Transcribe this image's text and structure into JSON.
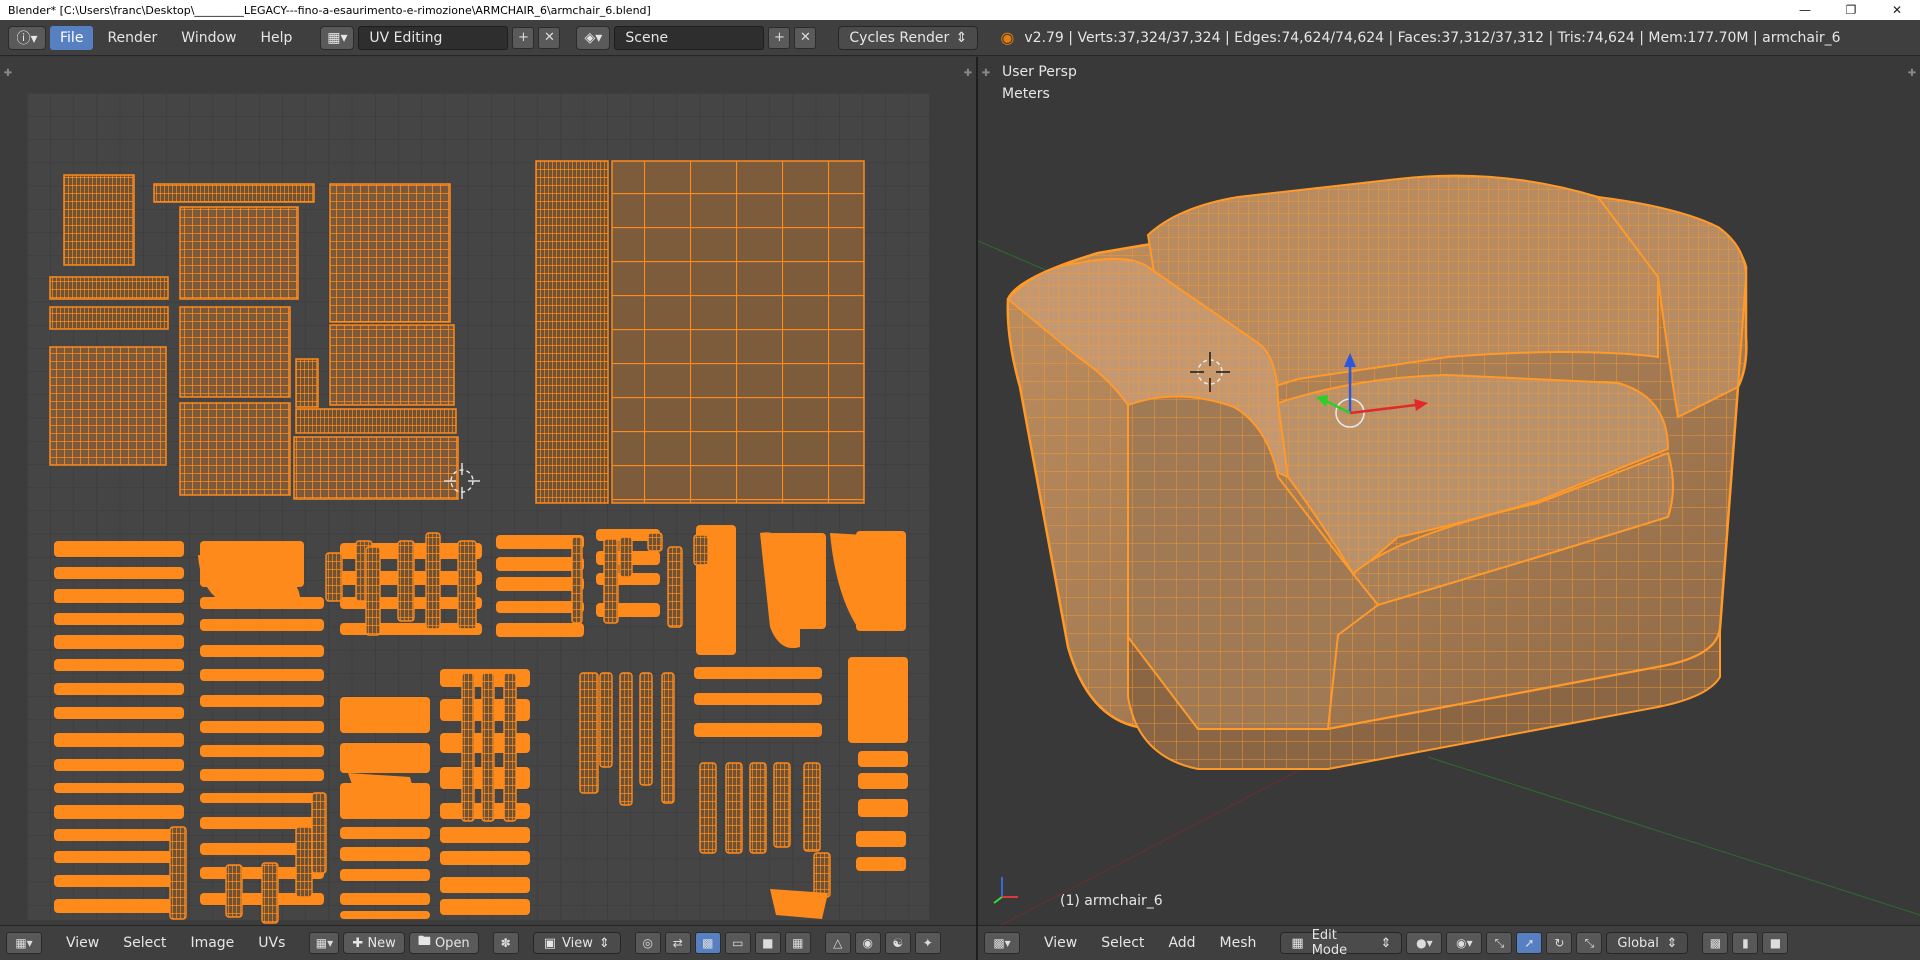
{
  "window": {
    "title": "Blender* [C:\\Users\\franc\\Desktop\\_________LEGACY---fino-a-esaurimento-e-rimozione\\ARMCHAIR_6\\armchair_6.blend]",
    "minimize_icon": "minimize-icon",
    "maximize_icon": "maximize-icon",
    "close_icon": "close-icon"
  },
  "infobar": {
    "menus": [
      "File",
      "Render",
      "Window",
      "Help"
    ],
    "screen_layout": "UV Editing",
    "scene": "Scene",
    "render_engine": "Cycles Render",
    "stats": "v2.79 | Verts:37,324/37,324 | Edges:74,624/74,624 | Faces:37,312/37,312 | Tris:74,624 | Mem:177.70M | armchair_6"
  },
  "viewport": {
    "view_name": "User Persp",
    "units": "Meters",
    "object_label": "(1) armchair_6"
  },
  "uv_footer": {
    "menus": [
      "View",
      "Select",
      "Image",
      "UVs"
    ],
    "new_label": "New",
    "open_label": "Open",
    "view_dropdown": "View"
  },
  "vp_footer": {
    "menus": [
      "View",
      "Select",
      "Add",
      "Mesh"
    ],
    "mode": "Edit Mode",
    "orientation": "Global"
  },
  "colors": {
    "accent": "#ff8a1c",
    "header_bg": "#3f3f3f",
    "active_menu": "#5680c2",
    "uv_bg": "#3c3c3c",
    "uv_tile": "#454545"
  }
}
